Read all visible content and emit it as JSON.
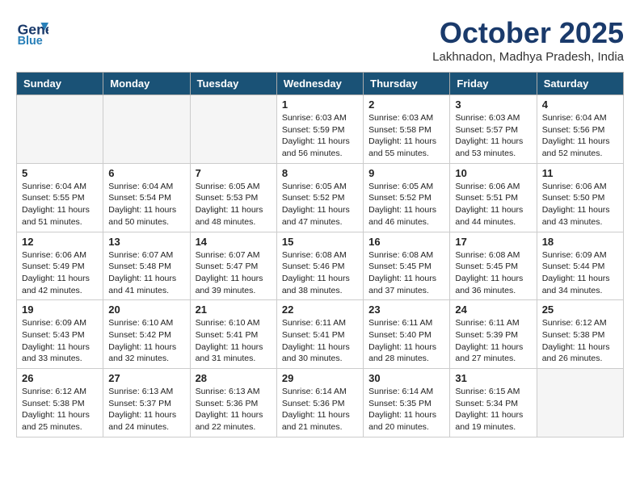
{
  "header": {
    "logo_line1": "General",
    "logo_line2": "Blue",
    "month": "October 2025",
    "location": "Lakhnadon, Madhya Pradesh, India"
  },
  "days_of_week": [
    "Sunday",
    "Monday",
    "Tuesday",
    "Wednesday",
    "Thursday",
    "Friday",
    "Saturday"
  ],
  "weeks": [
    [
      {
        "day": "",
        "content": ""
      },
      {
        "day": "",
        "content": ""
      },
      {
        "day": "",
        "content": ""
      },
      {
        "day": "1",
        "content": "Sunrise: 6:03 AM\nSunset: 5:59 PM\nDaylight: 11 hours\nand 56 minutes."
      },
      {
        "day": "2",
        "content": "Sunrise: 6:03 AM\nSunset: 5:58 PM\nDaylight: 11 hours\nand 55 minutes."
      },
      {
        "day": "3",
        "content": "Sunrise: 6:03 AM\nSunset: 5:57 PM\nDaylight: 11 hours\nand 53 minutes."
      },
      {
        "day": "4",
        "content": "Sunrise: 6:04 AM\nSunset: 5:56 PM\nDaylight: 11 hours\nand 52 minutes."
      }
    ],
    [
      {
        "day": "5",
        "content": "Sunrise: 6:04 AM\nSunset: 5:55 PM\nDaylight: 11 hours\nand 51 minutes."
      },
      {
        "day": "6",
        "content": "Sunrise: 6:04 AM\nSunset: 5:54 PM\nDaylight: 11 hours\nand 50 minutes."
      },
      {
        "day": "7",
        "content": "Sunrise: 6:05 AM\nSunset: 5:53 PM\nDaylight: 11 hours\nand 48 minutes."
      },
      {
        "day": "8",
        "content": "Sunrise: 6:05 AM\nSunset: 5:52 PM\nDaylight: 11 hours\nand 47 minutes."
      },
      {
        "day": "9",
        "content": "Sunrise: 6:05 AM\nSunset: 5:52 PM\nDaylight: 11 hours\nand 46 minutes."
      },
      {
        "day": "10",
        "content": "Sunrise: 6:06 AM\nSunset: 5:51 PM\nDaylight: 11 hours\nand 44 minutes."
      },
      {
        "day": "11",
        "content": "Sunrise: 6:06 AM\nSunset: 5:50 PM\nDaylight: 11 hours\nand 43 minutes."
      }
    ],
    [
      {
        "day": "12",
        "content": "Sunrise: 6:06 AM\nSunset: 5:49 PM\nDaylight: 11 hours\nand 42 minutes."
      },
      {
        "day": "13",
        "content": "Sunrise: 6:07 AM\nSunset: 5:48 PM\nDaylight: 11 hours\nand 41 minutes."
      },
      {
        "day": "14",
        "content": "Sunrise: 6:07 AM\nSunset: 5:47 PM\nDaylight: 11 hours\nand 39 minutes."
      },
      {
        "day": "15",
        "content": "Sunrise: 6:08 AM\nSunset: 5:46 PM\nDaylight: 11 hours\nand 38 minutes."
      },
      {
        "day": "16",
        "content": "Sunrise: 6:08 AM\nSunset: 5:45 PM\nDaylight: 11 hours\nand 37 minutes."
      },
      {
        "day": "17",
        "content": "Sunrise: 6:08 AM\nSunset: 5:45 PM\nDaylight: 11 hours\nand 36 minutes."
      },
      {
        "day": "18",
        "content": "Sunrise: 6:09 AM\nSunset: 5:44 PM\nDaylight: 11 hours\nand 34 minutes."
      }
    ],
    [
      {
        "day": "19",
        "content": "Sunrise: 6:09 AM\nSunset: 5:43 PM\nDaylight: 11 hours\nand 33 minutes."
      },
      {
        "day": "20",
        "content": "Sunrise: 6:10 AM\nSunset: 5:42 PM\nDaylight: 11 hours\nand 32 minutes."
      },
      {
        "day": "21",
        "content": "Sunrise: 6:10 AM\nSunset: 5:41 PM\nDaylight: 11 hours\nand 31 minutes."
      },
      {
        "day": "22",
        "content": "Sunrise: 6:11 AM\nSunset: 5:41 PM\nDaylight: 11 hours\nand 30 minutes."
      },
      {
        "day": "23",
        "content": "Sunrise: 6:11 AM\nSunset: 5:40 PM\nDaylight: 11 hours\nand 28 minutes."
      },
      {
        "day": "24",
        "content": "Sunrise: 6:11 AM\nSunset: 5:39 PM\nDaylight: 11 hours\nand 27 minutes."
      },
      {
        "day": "25",
        "content": "Sunrise: 6:12 AM\nSunset: 5:38 PM\nDaylight: 11 hours\nand 26 minutes."
      }
    ],
    [
      {
        "day": "26",
        "content": "Sunrise: 6:12 AM\nSunset: 5:38 PM\nDaylight: 11 hours\nand 25 minutes."
      },
      {
        "day": "27",
        "content": "Sunrise: 6:13 AM\nSunset: 5:37 PM\nDaylight: 11 hours\nand 24 minutes."
      },
      {
        "day": "28",
        "content": "Sunrise: 6:13 AM\nSunset: 5:36 PM\nDaylight: 11 hours\nand 22 minutes."
      },
      {
        "day": "29",
        "content": "Sunrise: 6:14 AM\nSunset: 5:36 PM\nDaylight: 11 hours\nand 21 minutes."
      },
      {
        "day": "30",
        "content": "Sunrise: 6:14 AM\nSunset: 5:35 PM\nDaylight: 11 hours\nand 20 minutes."
      },
      {
        "day": "31",
        "content": "Sunrise: 6:15 AM\nSunset: 5:34 PM\nDaylight: 11 hours\nand 19 minutes."
      },
      {
        "day": "",
        "content": ""
      }
    ]
  ]
}
